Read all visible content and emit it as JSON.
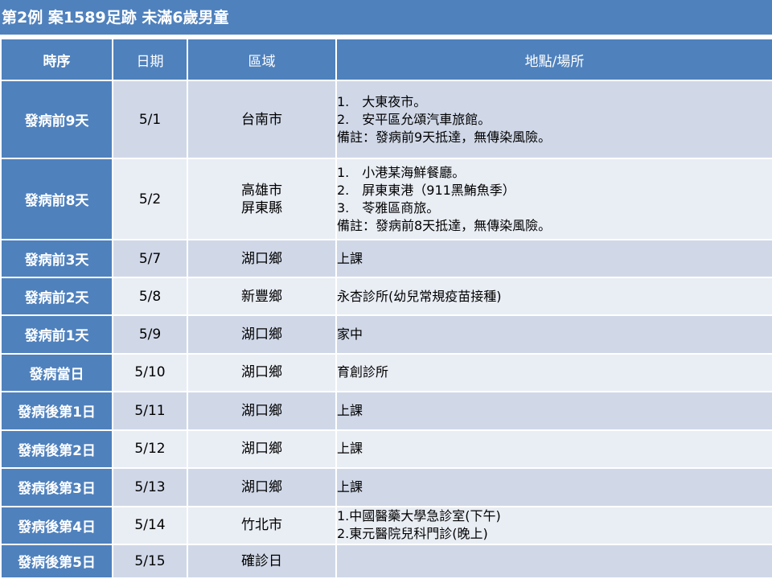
{
  "title": "第2例 案1589足跡 未滿6歲男童",
  "headers": [
    "時序",
    "日期",
    "區域",
    "地點/場所"
  ],
  "rows": [
    {
      "seq": "發病前9天",
      "date": "5/1",
      "area": [
        "台南市"
      ],
      "places": [
        "1.　大東夜市。",
        "2.　安平區允頌汽車旅館。",
        "備註：發病前9天抵達，無傳染風險。"
      ]
    },
    {
      "seq": "發病前8天",
      "date": "5/2",
      "area": [
        "高雄市",
        "屏東縣"
      ],
      "places": [
        "1.　小港某海鮮餐廳。",
        "2.　屏東東港（911黑鮪魚季）",
        "3.　苓雅區商旅。",
        "備註：發病前8天抵達，無傳染風險。"
      ]
    },
    {
      "seq": "發病前3天",
      "date": "5/7",
      "area": [
        "湖口鄉"
      ],
      "places": [
        "上課"
      ]
    },
    {
      "seq": "發病前2天",
      "date": "5/8",
      "area": [
        "新豐鄉"
      ],
      "places": [
        "永杏診所(幼兒常規疫苗接種)"
      ]
    },
    {
      "seq": "發病前1天",
      "date": "5/9",
      "area": [
        "湖口鄉"
      ],
      "places": [
        "家中"
      ]
    },
    {
      "seq": "發病當日",
      "date": "5/10",
      "area": [
        "湖口鄉"
      ],
      "places": [
        "育創診所"
      ]
    },
    {
      "seq": "發病後第1日",
      "date": "5/11",
      "area": [
        "湖口鄉"
      ],
      "places": [
        "上課"
      ]
    },
    {
      "seq": "發病後第2日",
      "date": "5/12",
      "area": [
        "湖口鄉"
      ],
      "places": [
        "上課"
      ]
    },
    {
      "seq": "發病後第3日",
      "date": "5/13",
      "area": [
        "湖口鄉"
      ],
      "places": [
        "上課"
      ]
    },
    {
      "seq": "發病後第4日",
      "date": "5/14",
      "area": [
        "竹北市"
      ],
      "places": [
        "1.中國醫藥大學急診室(下午)",
        "2.東元醫院兒科門診(晚上)"
      ]
    },
    {
      "seq": "發病後第5日",
      "date": "5/15",
      "area": [
        "確診日"
      ],
      "places": []
    }
  ],
  "colors": {
    "header_bg": "#4f81bd",
    "row_odd": "#d0d8e8",
    "row_even": "#e9edf4"
  }
}
